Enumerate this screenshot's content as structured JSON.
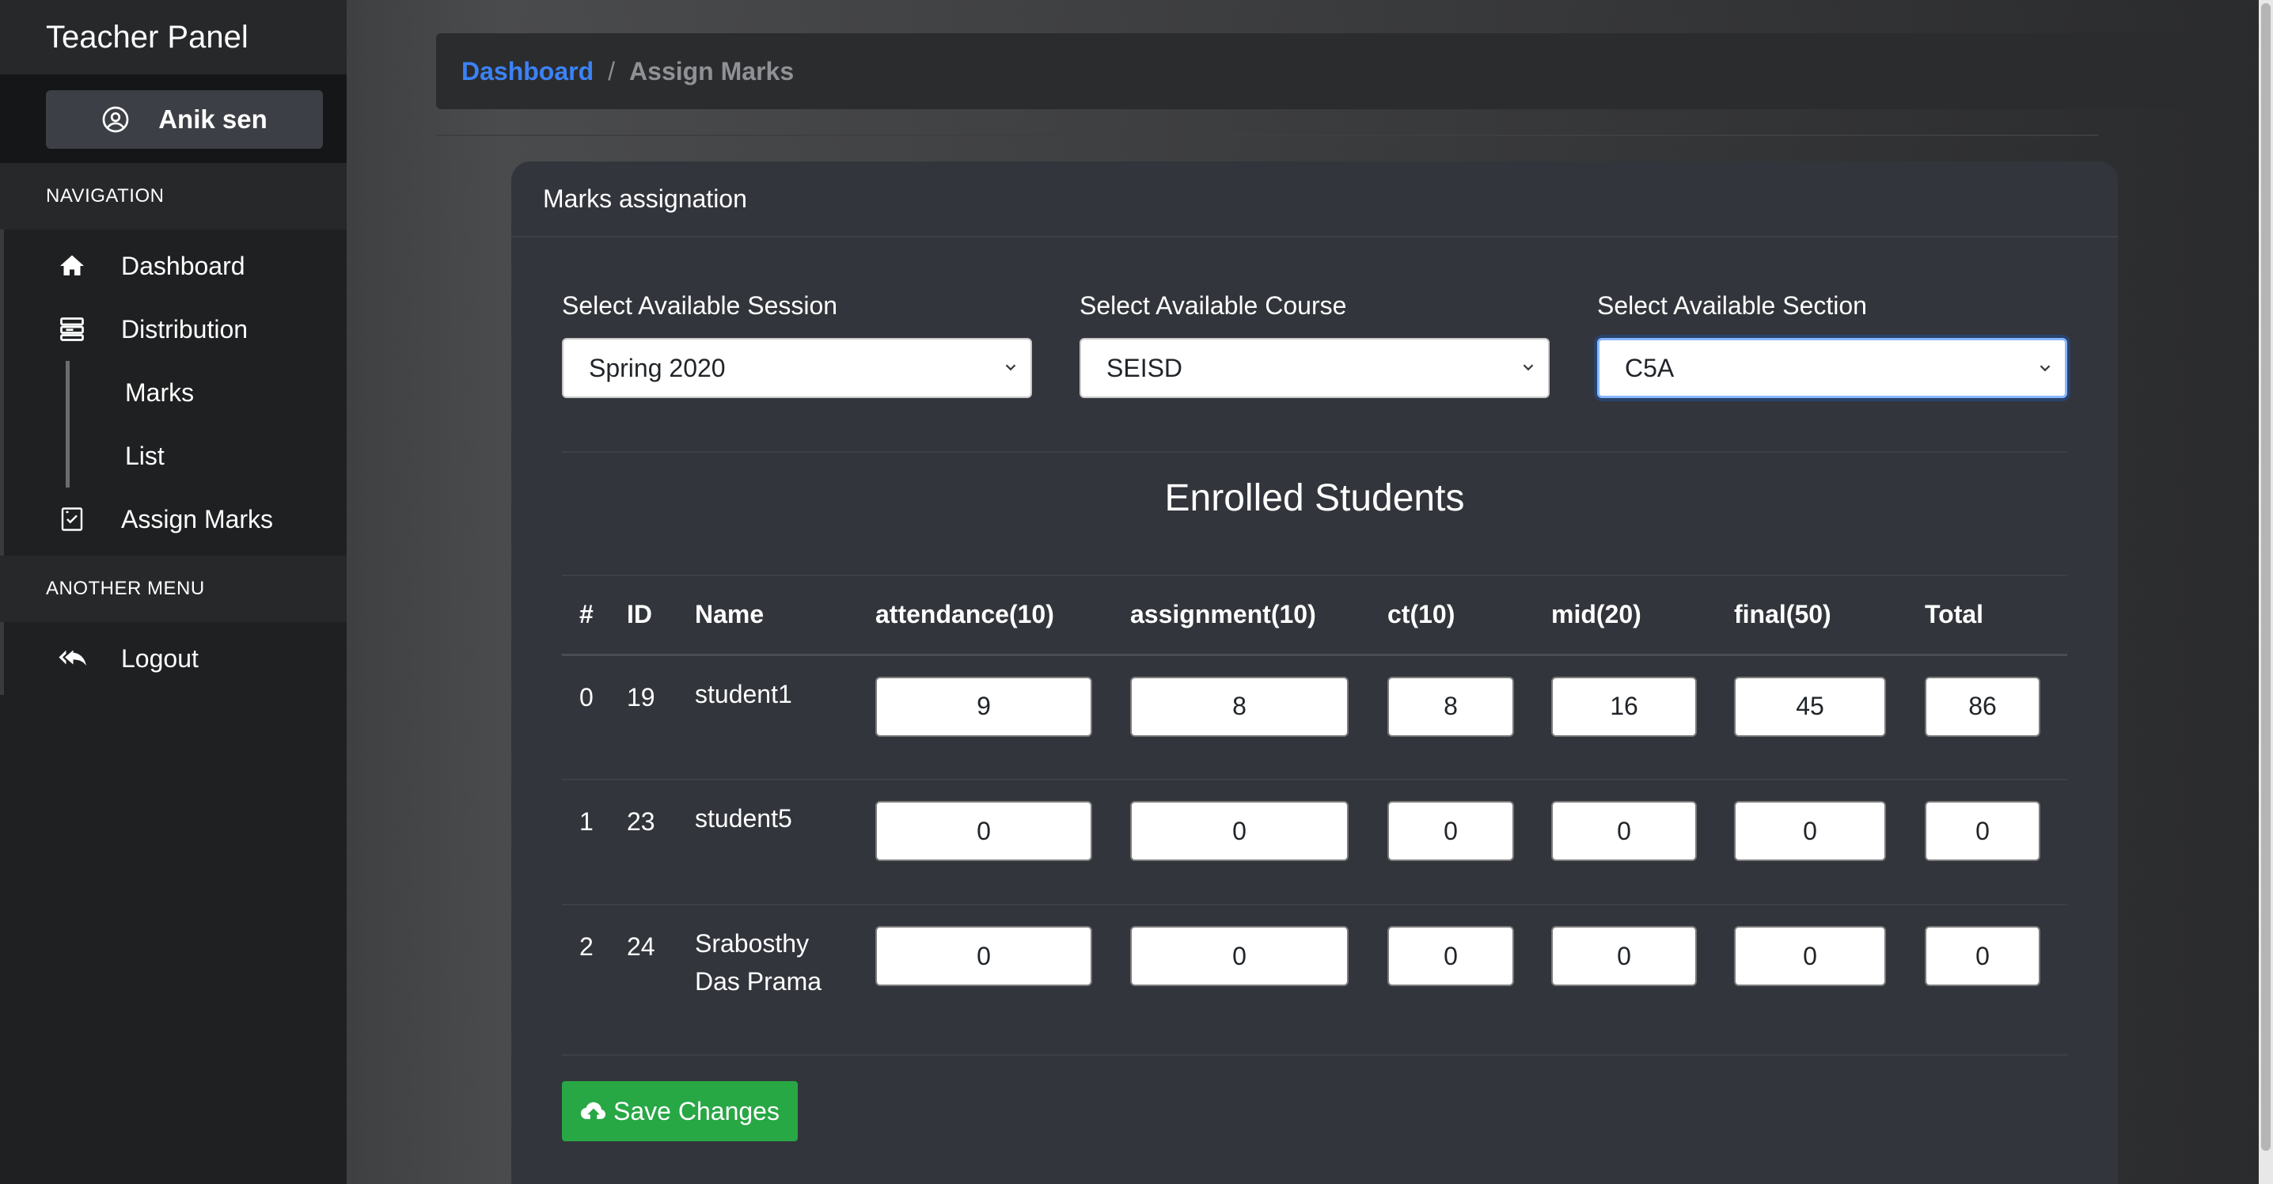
{
  "sidebar": {
    "brand": "Teacher Panel",
    "user_name": "Anik sen",
    "nav_heading": "NAVIGATION",
    "items": [
      {
        "label": "Dashboard",
        "icon": "home-icon"
      },
      {
        "label": "Distribution",
        "icon": "server-icon"
      },
      {
        "label": "Marks",
        "icon": ""
      },
      {
        "label": "List",
        "icon": ""
      },
      {
        "label": "Assign Marks",
        "icon": "checklist-icon"
      }
    ],
    "another_heading": "ANOTHER MENU",
    "logout_label": "Logout"
  },
  "breadcrumb": {
    "link": "Dashboard",
    "separator": "/",
    "current": "Assign Marks"
  },
  "card": {
    "title": "Marks assignation",
    "session": {
      "label": "Select Available Session",
      "value": "Spring 2020"
    },
    "course": {
      "label": "Select Available Course",
      "value": "SEISD"
    },
    "section": {
      "label": "Select Available Section",
      "value": "C5A"
    },
    "table_title": "Enrolled Students",
    "columns": [
      "#",
      "ID",
      "Name",
      "attendance(10)",
      "assignment(10)",
      "ct(10)",
      "mid(20)",
      "final(50)",
      "Total"
    ],
    "rows": [
      {
        "idx": "0",
        "id": "19",
        "name": "student1",
        "name2": "",
        "attendance": "9",
        "assignment": "8",
        "ct": "8",
        "mid": "16",
        "final": "45",
        "total": "86"
      },
      {
        "idx": "1",
        "id": "23",
        "name": "student5",
        "name2": "",
        "attendance": "0",
        "assignment": "0",
        "ct": "0",
        "mid": "0",
        "final": "0",
        "total": "0"
      },
      {
        "idx": "2",
        "id": "24",
        "name": "Srabosthy",
        "name2": "Das Prama",
        "attendance": "0",
        "assignment": "0",
        "ct": "0",
        "mid": "0",
        "final": "0",
        "total": "0"
      }
    ],
    "save_label": "Save Changes"
  },
  "colors": {
    "accent": "#3b82f6",
    "save_button": "#28a745"
  }
}
